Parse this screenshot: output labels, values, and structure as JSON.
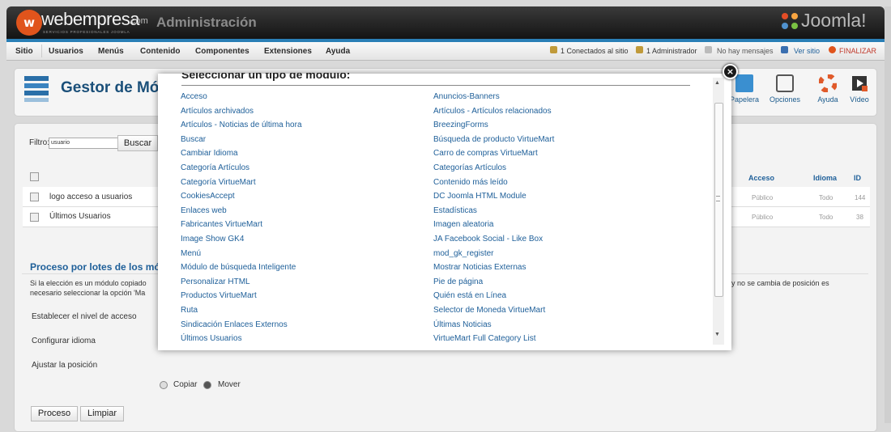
{
  "header": {
    "logo_letter": "w",
    "logo_text": "webempresa",
    "logo_suffix": ".com",
    "logo_tagline": "SERVICIOS PROFESIONALES JOOMLA",
    "admin_title": "Administración",
    "joomla_text": "Joomla!"
  },
  "menu": [
    "Sitio",
    "Usuarios",
    "Menús",
    "Contenido",
    "Componentes",
    "Extensiones",
    "Ayuda"
  ],
  "status": {
    "connected": "1 Conectados al sitio",
    "admin": "1 Administrador",
    "messages": "No hay mensajes",
    "view_site": "Ver sitio",
    "logout": "FINALIZAR"
  },
  "page": {
    "title": "Gestor de Mód",
    "toolbar": [
      {
        "label": "Papelera",
        "icon": "trash-icon"
      },
      {
        "label": "Opciones",
        "icon": "options-icon"
      },
      {
        "label": "Ayuda",
        "icon": "help-icon"
      },
      {
        "label": "Vídeo",
        "icon": "video-icon"
      }
    ]
  },
  "filter": {
    "label": "Filtro:",
    "value": "usuario",
    "search_label": "Buscar"
  },
  "table": {
    "headers": {
      "access": "Acceso",
      "language": "Idioma",
      "id": "ID"
    },
    "rows": [
      {
        "title": "logo acceso a usuarios",
        "access": "Público",
        "language": "Todo",
        "id": "144"
      },
      {
        "title": "Últimos Usuarios",
        "access": "Público",
        "language": "Todo",
        "id": "38"
      }
    ]
  },
  "batch": {
    "title": "Proceso por lotes de los módul",
    "desc1": "Si la elección es un módulo copiado",
    "desc2": "necesario seleccionar la opción 'Ma",
    "desc_right": "y no se cambia de posición es",
    "access_label": "Establecer el nivel de acceso",
    "language_label": "Configurar idioma",
    "position_label": "Ajustar la posición",
    "copy_label": "Copiar",
    "move_label": "Mover",
    "process_label": "Proceso",
    "clear_label": "Limpiar"
  },
  "modal": {
    "heading": "Seleccionar un tipo de módulo:",
    "close_label": "×",
    "left_column": [
      "Acceso",
      "Artículos archivados",
      "Artículos - Noticias de última hora",
      "Buscar",
      "Cambiar Idioma",
      "Categoría Artículos",
      "Categoría VirtueMart",
      "CookiesAccept",
      "Enlaces web",
      "Fabricantes VirtueMart",
      "Image Show GK4",
      "Menú",
      "Módulo de búsqueda Inteligente",
      "Personalizar HTML",
      "Productos VirtueMart",
      "Ruta",
      "Sindicación Enlaces Externos",
      "Últimos Usuarios"
    ],
    "right_column": [
      "Anuncios-Banners",
      "Artículos - Artículos relacionados",
      "BreezingForms",
      "Búsqueda de producto VirtueMart",
      "Carro de compras VirtueMart",
      "Categorías Artículos",
      "Contenido más leído",
      "DC Joomla HTML Module",
      "Estadísticas",
      "Imagen aleatoria",
      "JA Facebook Social - Like Box",
      "mod_gk_register",
      "Mostrar Noticias Externas",
      "Pie de página",
      "Quién está en Línea",
      "Selector de Moneda VirtueMart",
      "Últimas Noticias",
      "VirtueMart Full Category List"
    ]
  },
  "colors": {
    "accent": "#1e5f99",
    "brand": "#e0541c",
    "header_bg": "#1c1c1c",
    "strip": "#2a7fb6"
  }
}
